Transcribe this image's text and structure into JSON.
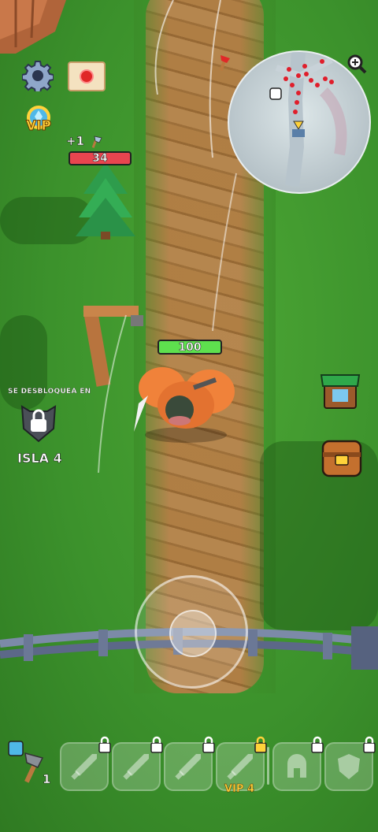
{
  "hud": {
    "reward_text": "+1",
    "tree_hp": "34",
    "player_hp": "100",
    "vip_label": "VIP",
    "vip_slot_label": "VIP 4",
    "axe_count": "1"
  },
  "unlock": {
    "label": "SE DESBLOQUEA EN",
    "island": "ISLA 4"
  },
  "icons": [
    "gear-icon",
    "mail-icon",
    "vip-badge-icon",
    "zoom-icon",
    "lock-icon",
    "shop-icon",
    "chest-icon",
    "axe-icon",
    "sword-icon",
    "helmet-icon",
    "shield-icon"
  ],
  "colors": {
    "grass": "#3c922c",
    "path": "#b57d45",
    "hp_red": "#e8454f",
    "hp_green": "#5ee04e",
    "vip_gold": "#ffd23a"
  },
  "slots": {
    "count": 7,
    "locked_sword_slots": 4
  }
}
